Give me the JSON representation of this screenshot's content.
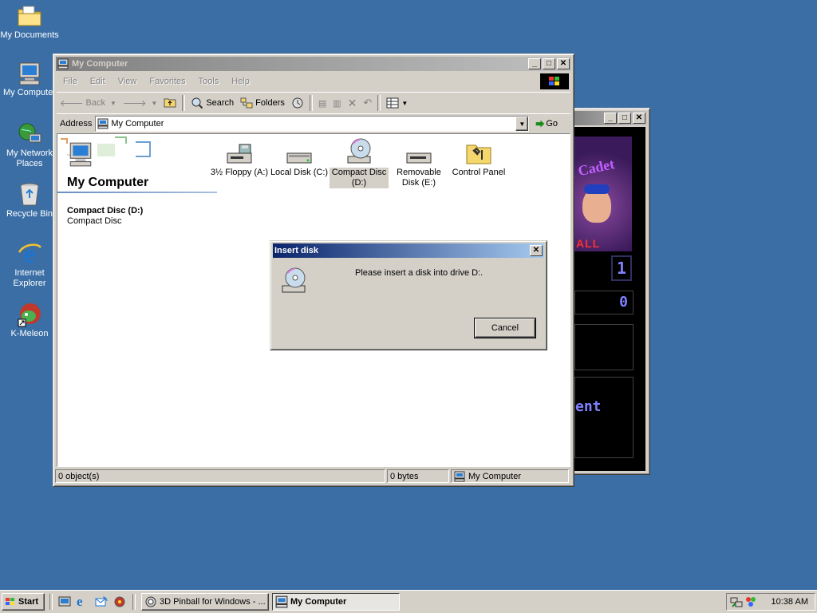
{
  "desktop": {
    "icons": [
      {
        "label": "My Documents",
        "icon": "folder-documents-icon"
      },
      {
        "label": "My Computer",
        "icon": "computer-icon"
      },
      {
        "label": "My Network Places",
        "icon": "network-icon"
      },
      {
        "label": "Recycle Bin",
        "icon": "recycle-bin-icon"
      },
      {
        "label": "Internet Explorer",
        "icon": "internet-explorer-icon"
      },
      {
        "label": "K-Meleon",
        "icon": "k-meleon-icon"
      }
    ]
  },
  "pinball_window": {
    "title": "",
    "score_left": "1",
    "score_right": "0",
    "label_all": "ALL",
    "label_ent": "ent",
    "banner": "e Cadet"
  },
  "explorer": {
    "title": "My Computer",
    "menu": [
      "File",
      "Edit",
      "View",
      "Favorites",
      "Tools",
      "Help"
    ],
    "toolbar": {
      "back": "Back",
      "search": "Search",
      "folders": "Folders"
    },
    "address": {
      "label": "Address",
      "value": "My Computer",
      "go": "Go"
    },
    "panel": {
      "title": "My Computer",
      "selected_name": "Compact Disc (D:)",
      "selected_type": "Compact Disc"
    },
    "items": [
      {
        "label": "3½ Floppy (A:)",
        "icon": "floppy-drive-icon"
      },
      {
        "label": "Local Disk (C:)",
        "icon": "hard-disk-icon"
      },
      {
        "label": "Compact Disc (D:)",
        "icon": "cd-drive-icon",
        "selected": true
      },
      {
        "label": "Removable Disk (E:)",
        "icon": "removable-disk-icon"
      },
      {
        "label": "Control Panel",
        "icon": "control-panel-icon"
      }
    ],
    "status": {
      "objects": "0 object(s)",
      "size": "0 bytes",
      "zone": "My Computer"
    }
  },
  "dialog": {
    "title": "Insert disk",
    "message": "Please insert a disk into drive D:.",
    "cancel": "Cancel"
  },
  "taskbar": {
    "start": "Start",
    "tasks": [
      {
        "label": "3D Pinball for Windows - ...",
        "active": false
      },
      {
        "label": "My Computer",
        "active": true
      }
    ],
    "clock": "10:38 AM"
  }
}
